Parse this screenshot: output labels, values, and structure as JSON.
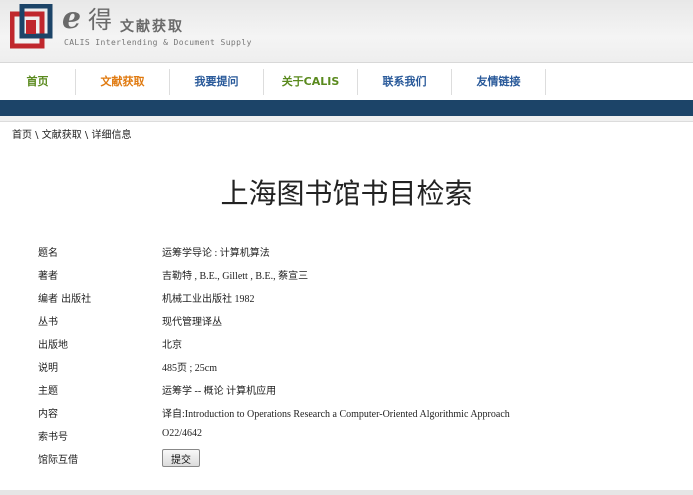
{
  "logo": {
    "e_letter": "e",
    "de_char": "得",
    "cn_name": "文献获取",
    "en_name": "CALIS Interlending & Document Supply",
    "icon": "calis-logo-icon"
  },
  "nav": {
    "items": [
      {
        "label": "首页",
        "color": "#5a8a1e"
      },
      {
        "label": "文献获取",
        "color": "#e07a10"
      },
      {
        "label": "我要提问",
        "color": "#2a5a9a"
      },
      {
        "label": "关于CALIS",
        "color": "#5a8a1e"
      },
      {
        "label": "联系我们",
        "color": "#2a5a9a"
      },
      {
        "label": "友情链接",
        "color": "#2a5a9a"
      }
    ]
  },
  "colors": {
    "bar": "#1c4468"
  },
  "breadcrumb": {
    "home": "首页",
    "sep": " \\ ",
    "section": "文献获取",
    "current": "详细信息"
  },
  "title": "上海图书馆书目检索",
  "record": [
    {
      "label": "题名",
      "value": "运筹学导论 : 计算机算法"
    },
    {
      "label": "著者",
      "value": "吉勒特 , B.E., Gillett , B.E., 蔡宣三"
    },
    {
      "label": "编者 出版社",
      "value": "机械工业出版社 1982"
    },
    {
      "label": "丛书",
      "value": "现代管理译丛"
    },
    {
      "label": "出版地",
      "value": "北京"
    },
    {
      "label": "说明",
      "value": "485页 ; 25cm"
    },
    {
      "label": "主题",
      "value": "运筹学 -- 概论  计算机应用"
    },
    {
      "label": "内容",
      "value": "译自:Introduction to Operations Research a Computer-Oriented Algorithmic Approach"
    },
    {
      "label": "索书号",
      "value": "O22/4642"
    },
    {
      "label": "馆际互借",
      "button": "提交"
    }
  ]
}
